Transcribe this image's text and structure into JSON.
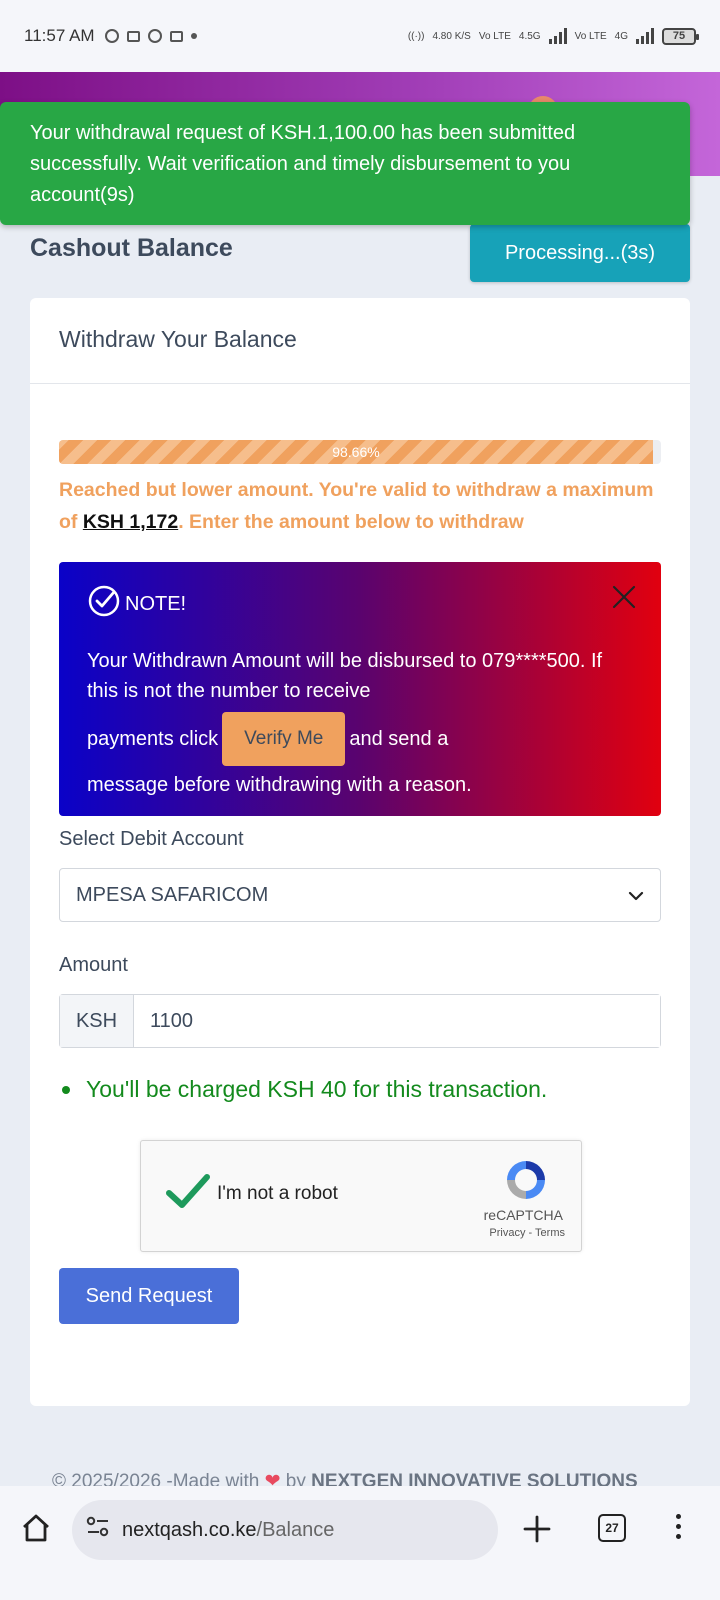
{
  "status_bar": {
    "time": "11:57 AM",
    "network_speed": "4.80",
    "network_speed_unit": "K/S",
    "net1": "Vo LTE",
    "net2": "4.5G",
    "net3": "Vo LTE",
    "net4": "4G",
    "battery": "75"
  },
  "toast": {
    "message": "Your withdrawal request of KSH.1,100.00 has been submitted successfully. Wait verification and timely disbursement to you account(9s)"
  },
  "page": {
    "title": "Cashout Balance",
    "processing_label": "Processing...(3s)"
  },
  "card": {
    "header": "Withdraw Your Balance",
    "progress_label": "98.66%",
    "progress_value": 98.66,
    "reached_pre": "Reached but lower amount. You're valid to withdraw a maximum of ",
    "reached_amount": "KSH 1,172",
    "reached_post": ". Enter the amount below to withdraw"
  },
  "note": {
    "title": "NOTE!",
    "line1": "Your Withdrawn Amount will be disbursed to 079****500. If this is not the number to receive",
    "line2_pre": "payments click",
    "verify_label": "Verify Me",
    "line2_post": "and send a",
    "line3": "message before withdrawing with a reason."
  },
  "form": {
    "debit_label": "Select Debit Account",
    "debit_value": "MPESA SAFARICOM",
    "amount_label": "Amount",
    "amount_prefix": "KSH",
    "amount_value": "1100",
    "charge_note": "You'll be charged KSH 40 for this transaction.",
    "send_label": "Send Request"
  },
  "recaptcha": {
    "label": "I'm not a robot",
    "brand": "reCAPTCHA",
    "privacy": "Privacy",
    "separator": " - ",
    "terms": "Terms"
  },
  "footer": {
    "pre": "© 2025/2026 -Made with ",
    "heart": "❤",
    "by": " by ",
    "company": "NEXTGEN INNOVATIVE SOLUTIONS"
  },
  "browser": {
    "url_domain": "nextqash.co.ke",
    "url_path": "/Balance",
    "tab_count": "27"
  },
  "colors": {
    "toast_bg": "#28a745",
    "processing_bg": "#17a2b8",
    "accent_orange": "#f0a15e",
    "send_btn": "#4a6fd8",
    "charge_green": "#138a1d",
    "header_purple": "#7d0f86"
  }
}
